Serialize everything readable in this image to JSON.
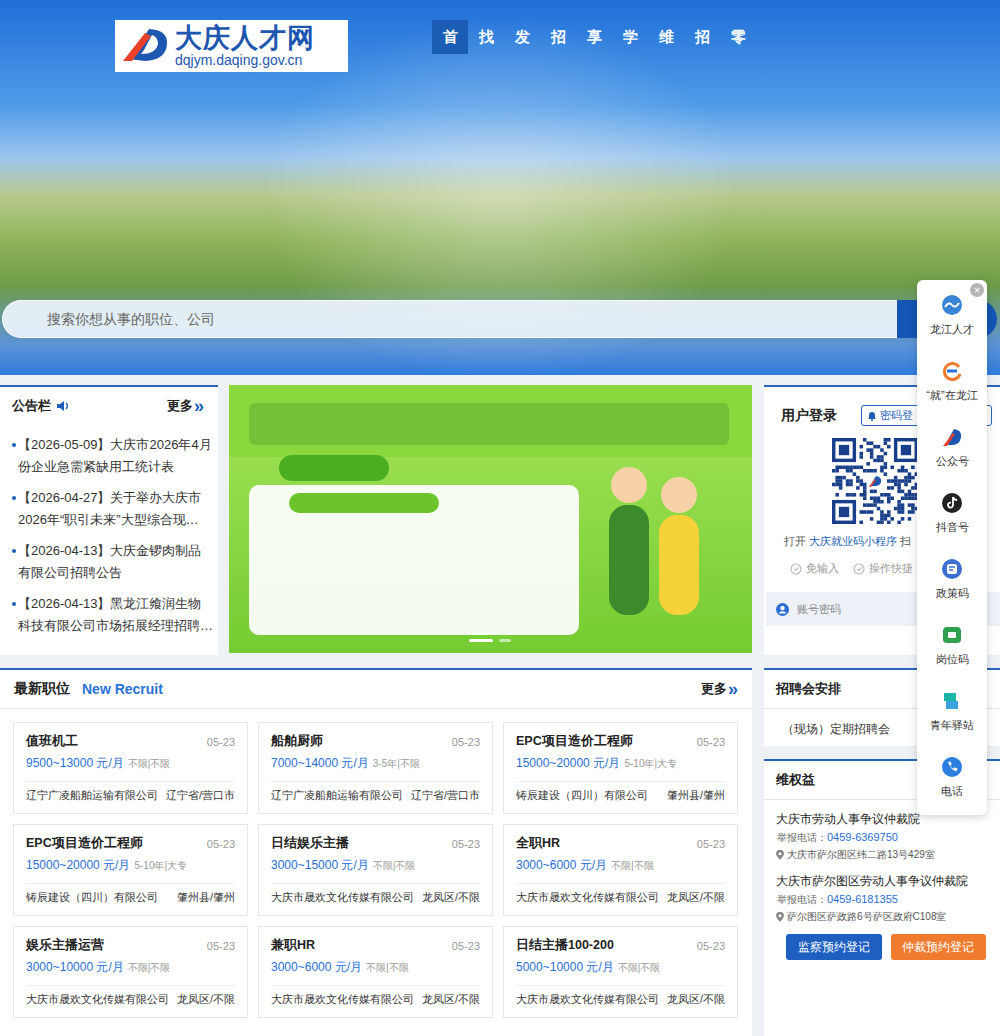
{
  "header": {
    "logo": {
      "title": "大庆人才网",
      "url": "dqjym.daqing.gov.cn"
    },
    "nav": [
      {
        "label": "首",
        "selected": true
      },
      {
        "label": "找",
        "selected": false
      },
      {
        "label": "发",
        "selected": false
      },
      {
        "label": "招",
        "selected": false
      },
      {
        "label": "享",
        "selected": false
      },
      {
        "label": "学",
        "selected": false
      },
      {
        "label": "维",
        "selected": false
      },
      {
        "label": "招",
        "selected": false
      },
      {
        "label": "零",
        "selected": false
      }
    ]
  },
  "search": {
    "placeholder": "搜索你想从事的职位、公司"
  },
  "notices": {
    "title": "公告栏",
    "more": "更多",
    "more_icon": "»",
    "items": [
      "【2026-05-09】大庆市2026年4月份企业急需紧缺用工统计表",
      "【2026-04-27】关于举办大庆市2026年“职引未来”大型综合现…",
      "【2026-04-13】大庆金锣肉制品有限公司招聘公告",
      "【2026-04-13】黑龙江飨润生物科技有限公司市场拓展经理招聘…"
    ]
  },
  "login": {
    "title": "用户登录",
    "mode_button": "密码登",
    "open_prefix": "打开",
    "mini_program": "大庆就业码小程序",
    "open_suffix": "扫",
    "features": [
      "免输入",
      "操作快捷"
    ],
    "account": {
      "placeholder": "账号密码"
    }
  },
  "jobs": {
    "title": "最新职位",
    "subtitle": "New Recruit",
    "more": "更多",
    "more_icon": "»",
    "items": [
      {
        "title": "值班机工",
        "date": "05-23",
        "salary": "9500~13000 元/月",
        "req": "不限|不限",
        "company": "辽宁广凌船舶运输有限公司",
        "location": "辽宁省/营口市"
      },
      {
        "title": "船舶厨师",
        "date": "05-23",
        "salary": "7000~14000 元/月",
        "req": "3-5年|不限",
        "company": "辽宁广凌船舶运输有限公司",
        "location": "辽宁省/营口市"
      },
      {
        "title": "EPC项目造价工程师",
        "date": "05-23",
        "salary": "15000~20000 元/月",
        "req": "5-10年|大专",
        "company": "铸辰建设（四川）有限公司",
        "location": "肇州县/肇州"
      },
      {
        "title": "EPC项目造价工程师",
        "date": "05-23",
        "salary": "15000~20000 元/月",
        "req": "5-10年|大专",
        "company": "铸辰建设（四川）有限公司",
        "location": "肇州县/肇州"
      },
      {
        "title": "日结娱乐主播",
        "date": "05-23",
        "salary": "3000~15000 元/月",
        "req": "不限|不限",
        "company": "大庆市晟欢文化传媒有限公司",
        "location": "龙凤区/不限"
      },
      {
        "title": "全职HR",
        "date": "05-23",
        "salary": "3000~6000 元/月",
        "req": "不限|不限",
        "company": "大庆市晟欢文化传媒有限公司",
        "location": "龙凤区/不限"
      },
      {
        "title": "娱乐主播运营",
        "date": "05-23",
        "salary": "3000~10000 元/月",
        "req": "不限|不限",
        "company": "大庆市晟欢文化传媒有限公司",
        "location": "龙凤区/不限"
      },
      {
        "title": "兼职HR",
        "date": "05-23",
        "salary": "3000~6000 元/月",
        "req": "不限|不限",
        "company": "大庆市晟欢文化传媒有限公司",
        "location": "龙凤区/不限"
      },
      {
        "title": "日结主播100-200",
        "date": "05-23",
        "salary": "5000~10000 元/月",
        "req": "不限|不限",
        "company": "大庆市晟欢文化传媒有限公司",
        "location": "龙凤区/不限"
      }
    ]
  },
  "fairs": {
    "title": "招聘会安排",
    "items": [
      "（现场）定期招聘会"
    ]
  },
  "rights": {
    "title": "维权益",
    "items": [
      {
        "name": "大庆市劳动人事争议仲裁院",
        "phone_label": "举报电话：",
        "phone": "0459-6369750",
        "address": "大庆市萨尔图区纬二路13号429室"
      },
      {
        "name": "大庆市萨尔图区劳动人事争议仲裁院",
        "phone_label": "举报电话：",
        "phone": "0459-6181355",
        "address": "萨尔图区萨政路6号萨区政府C108室"
      }
    ],
    "buttons": [
      {
        "label": "监察预约登记",
        "color": "#1e5fc0"
      },
      {
        "label": "仲裁预约登记",
        "color": "#f07a2e"
      }
    ]
  },
  "float_bar": {
    "close": "×",
    "items": [
      {
        "label": "龙江人才"
      },
      {
        "label": "“就”在龙江"
      },
      {
        "label": "公众号"
      },
      {
        "label": "抖音号"
      },
      {
        "label": "政策码"
      },
      {
        "label": "岗位码"
      },
      {
        "label": "青年驿站"
      },
      {
        "label": "电话"
      }
    ]
  }
}
